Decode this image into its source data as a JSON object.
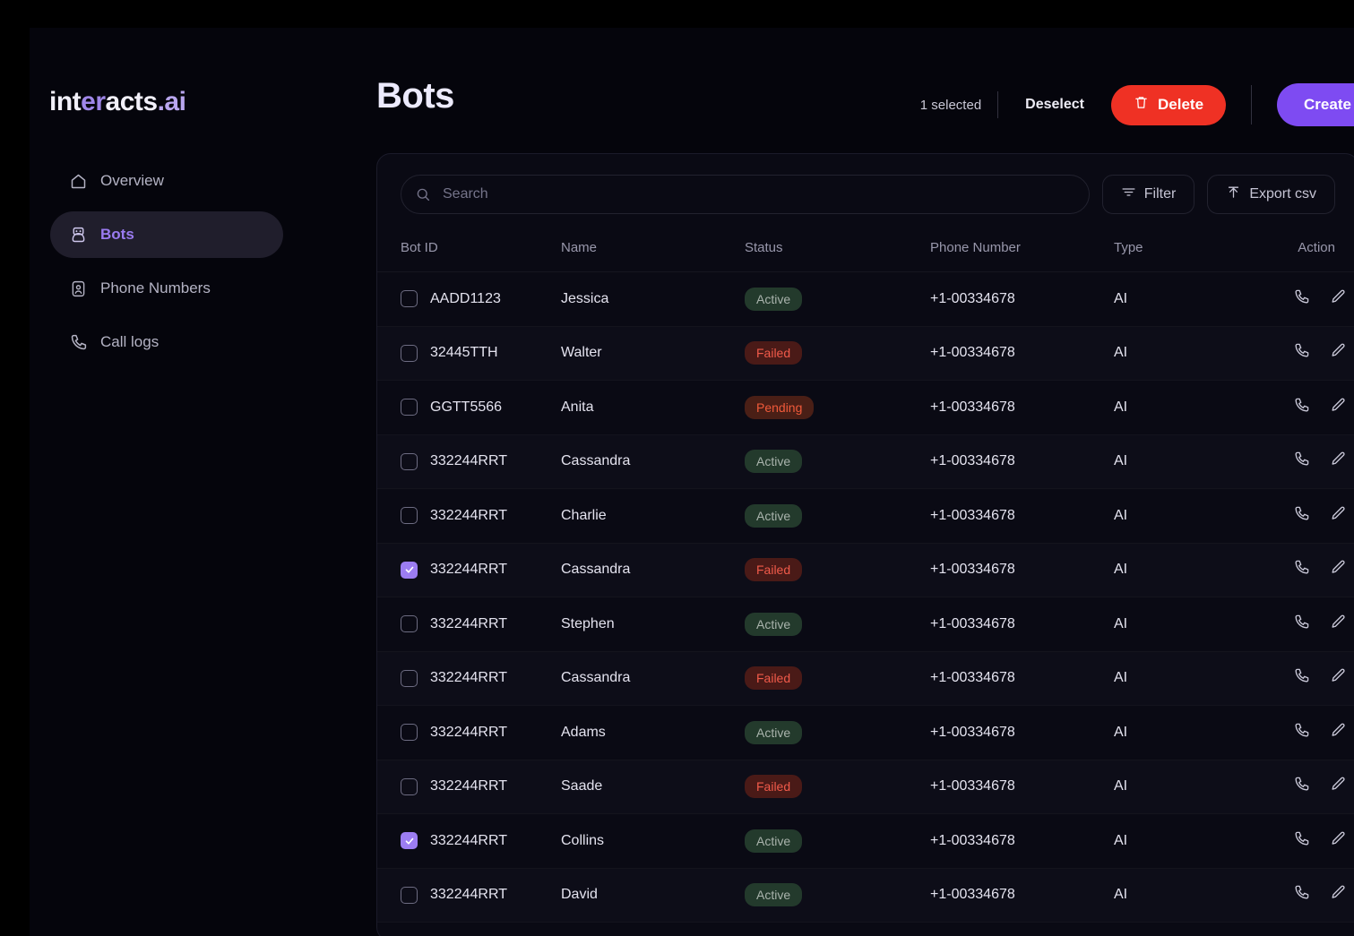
{
  "brand": {
    "part1": "int",
    "part2": "er",
    "part3": "acts",
    "part4": ".ai"
  },
  "sidebar": {
    "items": [
      {
        "label": "Overview",
        "icon": "home-icon",
        "active": false
      },
      {
        "label": "Bots",
        "icon": "robot-icon",
        "active": true
      },
      {
        "label": "Phone Numbers",
        "icon": "contact-card-icon",
        "active": false
      },
      {
        "label": "Call logs",
        "icon": "phone-icon",
        "active": false
      }
    ]
  },
  "header": {
    "title": "Bots",
    "selected_count_label": "1 selected",
    "deselect_label": "Deselect",
    "delete_label": "Delete",
    "create_label": "Create Bot"
  },
  "toolbar": {
    "search_placeholder": "Search",
    "search_value": "",
    "filter_label": "Filter",
    "export_label": "Export csv"
  },
  "table": {
    "columns": [
      "Bot ID",
      "Name",
      "Status",
      "Phone Number",
      "Type",
      "Action"
    ],
    "rows": [
      {
        "checked": false,
        "bot_id": "AADD1123",
        "name": "Jessica",
        "status": "Active",
        "phone": "+1-00334678",
        "type": "AI"
      },
      {
        "checked": false,
        "bot_id": "32445TTH",
        "name": "Walter",
        "status": "Failed",
        "phone": "+1-00334678",
        "type": "AI"
      },
      {
        "checked": false,
        "bot_id": "GGTT5566",
        "name": "Anita",
        "status": "Pending",
        "phone": "+1-00334678",
        "type": "AI"
      },
      {
        "checked": false,
        "bot_id": "332244RRT",
        "name": "Cassandra",
        "status": "Active",
        "phone": "+1-00334678",
        "type": "AI"
      },
      {
        "checked": false,
        "bot_id": "332244RRT",
        "name": "Charlie",
        "status": "Active",
        "phone": "+1-00334678",
        "type": "AI"
      },
      {
        "checked": true,
        "bot_id": "332244RRT",
        "name": "Cassandra",
        "status": "Failed",
        "phone": "+1-00334678",
        "type": "AI"
      },
      {
        "checked": false,
        "bot_id": "332244RRT",
        "name": "Stephen",
        "status": "Active",
        "phone": "+1-00334678",
        "type": "AI"
      },
      {
        "checked": false,
        "bot_id": "332244RRT",
        "name": "Cassandra",
        "status": "Failed",
        "phone": "+1-00334678",
        "type": "AI"
      },
      {
        "checked": false,
        "bot_id": "332244RRT",
        "name": "Adams",
        "status": "Active",
        "phone": "+1-00334678",
        "type": "AI"
      },
      {
        "checked": false,
        "bot_id": "332244RRT",
        "name": "Saade",
        "status": "Failed",
        "phone": "+1-00334678",
        "type": "AI"
      },
      {
        "checked": true,
        "bot_id": "332244RRT",
        "name": "Collins",
        "status": "Active",
        "phone": "+1-00334678",
        "type": "AI"
      },
      {
        "checked": false,
        "bot_id": "332244RRT",
        "name": "David",
        "status": "Active",
        "phone": "+1-00334678",
        "type": "AI"
      }
    ],
    "row_actions": [
      "call-icon",
      "edit-icon"
    ]
  },
  "colors": {
    "accent_purple": "#7e4bf2",
    "checkbox_purple": "#9c7df2",
    "delete_red": "#ef3124",
    "status_active_bg": "#233a2c",
    "status_failed_bg": "#4a1a17",
    "status_pending_bg": "#4a1f16",
    "page_bg": "#05050c"
  }
}
